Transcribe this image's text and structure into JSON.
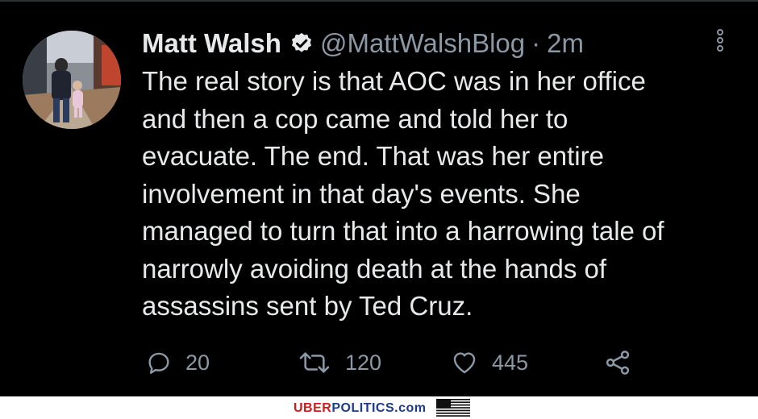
{
  "tweet": {
    "author_name": "Matt Walsh",
    "handle": "@MattWalshBlog",
    "separator": "·",
    "time": "2m",
    "lines": [
      "The real story is that AOC was in her office",
      "and then a cop came and told her to",
      "evacuate. The end. That was her entire",
      "involvement in that day's events. She",
      "managed to turn that into a harrowing tale of",
      "narrowly avoiding death at the hands of",
      "assassins sent by Ted Cruz."
    ],
    "replies": "20",
    "retweets": "120",
    "likes": "445"
  },
  "icons": {
    "verified": "verified-badge-icon",
    "more": "more-options-icon",
    "reply": "reply-icon",
    "retweet": "retweet-icon",
    "like": "heart-icon",
    "share": "share-icon"
  },
  "watermark": {
    "part1": "UBER",
    "part2": "POLITICS",
    "part3": ".com"
  },
  "colors": {
    "background": "#000000",
    "text": "#e7e9ea",
    "muted": "#8b98a5",
    "brand_red": "#d11a1a",
    "brand_blue": "#1e3a8a"
  }
}
